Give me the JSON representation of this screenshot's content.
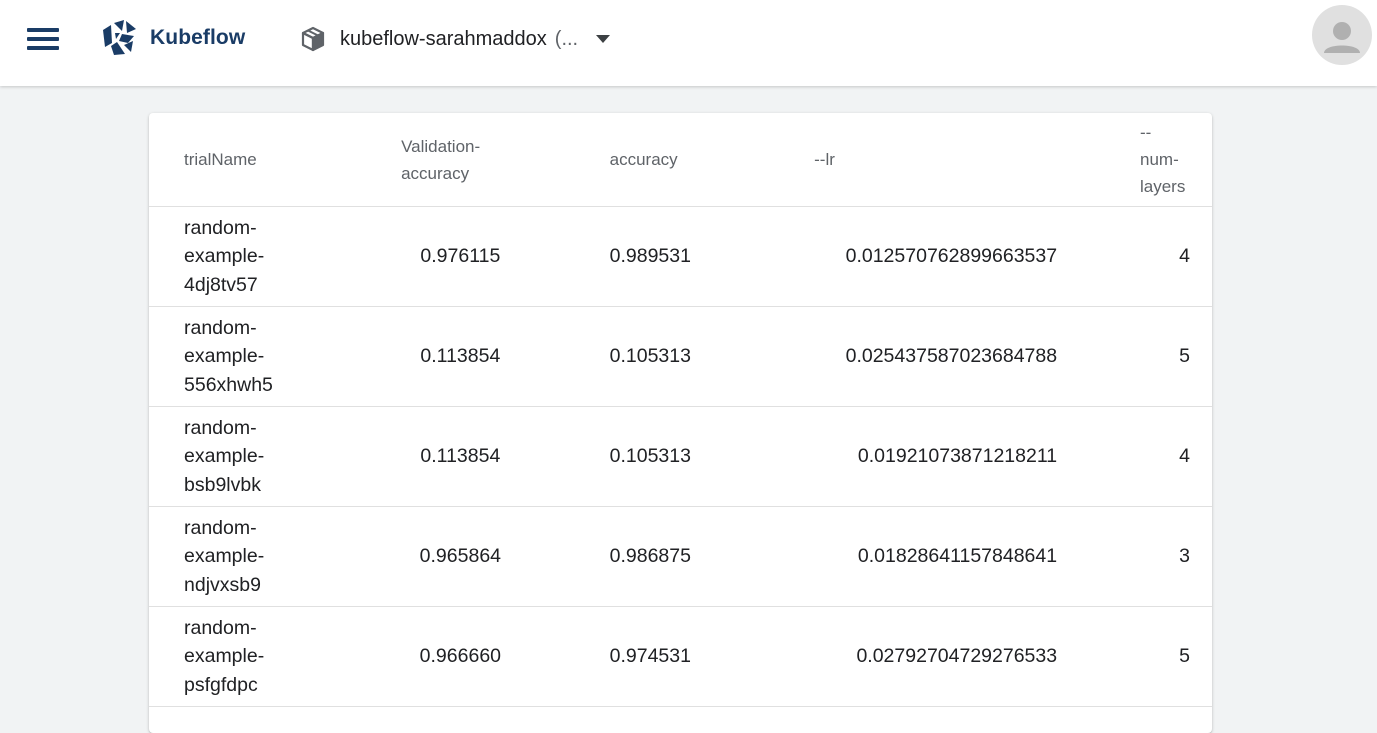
{
  "header": {
    "menu_icon": "hamburger-menu-icon",
    "logo_text": "Kubeflow",
    "logo_icon": "kubeflow-logo-icon",
    "namespace_icon": "cube-icon",
    "namespace": "kubeflow-sarahmaddox",
    "namespace_ellipsis": "(...",
    "dropdown_icon": "caret-down-icon",
    "avatar_icon": "account-avatar-icon"
  },
  "table": {
    "columns": [
      "trialName",
      "Validation-accuracy",
      "accuracy",
      "--lr",
      "--num-layers"
    ],
    "column_lines": [
      [
        "trialName"
      ],
      [
        "Validation-",
        "accuracy"
      ],
      [
        "accuracy"
      ],
      [
        "--lr"
      ],
      [
        "--",
        "num-",
        "layers"
      ]
    ],
    "rows": [
      {
        "name_lines": [
          "random-",
          "example-",
          "4dj8tv57"
        ],
        "validation_accuracy": "0.976115",
        "accuracy": "0.989531",
        "lr": "0.012570762899663537",
        "num_layers": "4"
      },
      {
        "name_lines": [
          "random-",
          "example-",
          "556xhwh5"
        ],
        "validation_accuracy": "0.113854",
        "accuracy": "0.105313",
        "lr": "0.025437587023684788",
        "num_layers": "5"
      },
      {
        "name_lines": [
          "random-",
          "example-",
          "bsb9lvbk"
        ],
        "validation_accuracy": "0.113854",
        "accuracy": "0.105313",
        "lr": "0.01921073871218211",
        "num_layers": "4"
      },
      {
        "name_lines": [
          "random-",
          "example-",
          "ndjvxsb9"
        ],
        "validation_accuracy": "0.965864",
        "accuracy": "0.986875",
        "lr": "0.01828641157848641",
        "num_layers": "3"
      },
      {
        "name_lines": [
          "random-",
          "example-",
          "psfgfdpc"
        ],
        "validation_accuracy": "0.966660",
        "accuracy": "0.974531",
        "lr": "0.02792704729276533",
        "num_layers": "5"
      }
    ]
  },
  "colors": {
    "brand": "#1a3c66",
    "background": "#f1f3f4",
    "divider": "#e0e0e0"
  }
}
